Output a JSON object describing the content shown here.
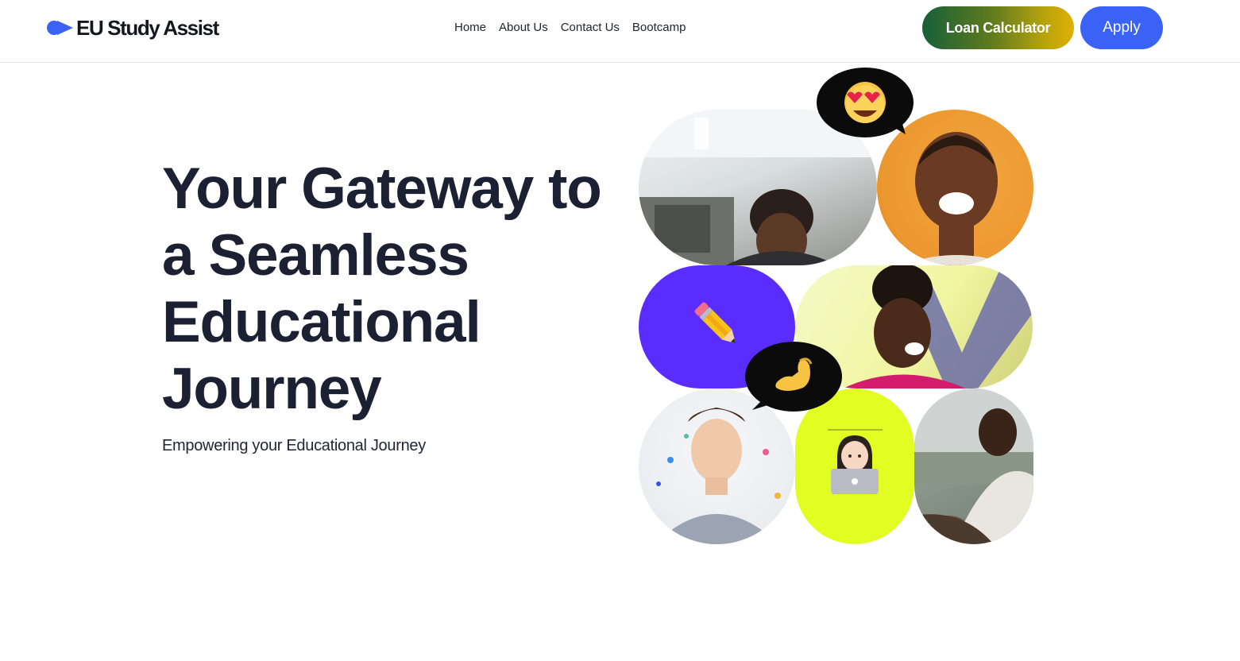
{
  "header": {
    "logo_text": "EU Study Assist",
    "nav": [
      {
        "label": "Home"
      },
      {
        "label": "About Us"
      },
      {
        "label": "Contact Us"
      },
      {
        "label": "Bootcamp"
      }
    ],
    "loan_button": "Loan Calculator",
    "apply_button": "Apply"
  },
  "hero": {
    "title": "Your Gateway to a Seamless Educational Journey",
    "subtitle": "Empowering your Educational Journey"
  },
  "collage": {
    "bubble_top_emoji": "heart-eyes-face",
    "pencil_emoji": "pencil",
    "bubble_mid_emoji": "pinched-fingers-hand",
    "laptop_emoji": "woman-technologist"
  },
  "colors": {
    "brand_blue": "#3a63f5",
    "purple_tile": "#5b2cff",
    "lime_tile": "#e1fd22",
    "orange_tile": "#ec972f",
    "loan_gradient_start": "#16603a",
    "loan_gradient_end": "#e0b004"
  }
}
